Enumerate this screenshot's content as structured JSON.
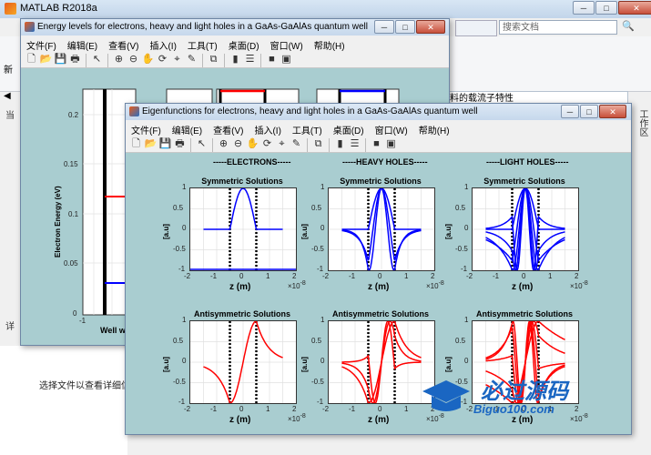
{
  "app": {
    "title": "MATLAB R2018a",
    "search_placeholder": "搜索文档",
    "status_text": "选择文件以查看详细信息",
    "right_strip_text": "料的载流子特性",
    "side_tab_text": "工作区",
    "left_hidden_text": "当",
    "left_hidden_text2": "详"
  },
  "fig1": {
    "title": "Energy levels for electrons, heavy and light holes in a GaAs-GaAlAs quantum well",
    "menu": [
      "文件(F)",
      "编辑(E)",
      "查看(V)",
      "插入(I)",
      "工具(T)",
      "桌面(D)",
      "窗口(W)",
      "帮助(H)"
    ],
    "ylabel": "Electron Energy (eV)",
    "xlabel": "Well wi",
    "yticks": [
      "0.2",
      "0.15",
      "0.1",
      "0.05",
      "0"
    ],
    "xticks": [
      "-1",
      "0"
    ]
  },
  "fig2": {
    "title": "Eigenfunctions for electrons, heavy and light holes in a GaAs-GaAlAs quantum well",
    "menu": [
      "文件(F)",
      "编辑(E)",
      "查看(V)",
      "插入(I)",
      "工具(T)",
      "桌面(D)",
      "窗口(W)",
      "帮助(H)"
    ],
    "sections": [
      "-----ELECTRONS-----",
      "-----HEAVY HOLES-----",
      "-----LIGHT HOLES-----"
    ],
    "row_titles": [
      "Symmetric Solutions",
      "Antisymmetric Solutions"
    ],
    "ylabel": "[a.u]",
    "xlabel": "z (m)",
    "xexp": "×10",
    "xexp_power": "-8",
    "yticks": [
      "1",
      "0.5",
      "0",
      "-0.5",
      "-1"
    ],
    "xticks": [
      "-2",
      "-1",
      "0",
      "1",
      "2"
    ]
  },
  "watermark": {
    "brand": "必过源码",
    "url": "Biguo100.com"
  },
  "colors": {
    "figure_bg": "#a9cdd0",
    "symmetric": "#0000ff",
    "antisymmetric": "#ff0000",
    "barrier": "#000000"
  }
}
